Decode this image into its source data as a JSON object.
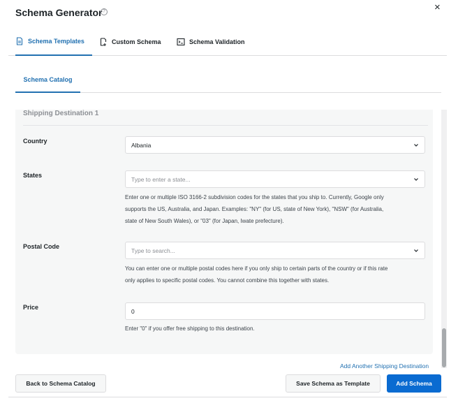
{
  "header": {
    "title": "Schema Generator",
    "help_glyph": "?",
    "close_glyph": "×"
  },
  "tabs": [
    {
      "label": "Schema Templates",
      "icon": "document-icon",
      "active": true
    },
    {
      "label": "Custom Schema",
      "icon": "file-add-icon",
      "active": false
    },
    {
      "label": "Schema Validation",
      "icon": "terminal-icon",
      "active": false
    }
  ],
  "subtabs": [
    {
      "label": "Schema Catalog",
      "active": true
    }
  ],
  "destination": {
    "title": "Shipping Destination 1",
    "country": {
      "label": "Country",
      "value": "Albania"
    },
    "states": {
      "label": "States",
      "placeholder": "Type to enter a state...",
      "help": [
        "Enter one or multiple ISO 3166-2 subdivision codes for the states that you ship to. Currently, Google only",
        "supports the US, Australia, and Japan. Examples: \"NY\" (for US, state of New York), \"NSW\" (for Australia,",
        "state of New South Wales), or \"03\" (for Japan, Iwate prefecture)."
      ]
    },
    "postal": {
      "label": "Postal Code",
      "placeholder": "Type to search...",
      "help": [
        "You can enter one or multiple postal codes here if you only ship to certain parts of the country or if this rate",
        "only applies to specific postal codes. You cannot combine this together with states."
      ]
    },
    "price": {
      "label": "Price",
      "value": "0",
      "help": "Enter \"0\" if you offer free shipping to this destination."
    }
  },
  "add_destination_label": "Add Another Shipping Destination",
  "footer": {
    "back_label": "Back to Schema Catalog",
    "save_template_label": "Save Schema as Template",
    "add_schema_label": "Add Schema"
  },
  "colors": {
    "accent": "#2271b1",
    "primary_button": "#0a6bd1",
    "panel_bg": "#f6f7f7"
  }
}
